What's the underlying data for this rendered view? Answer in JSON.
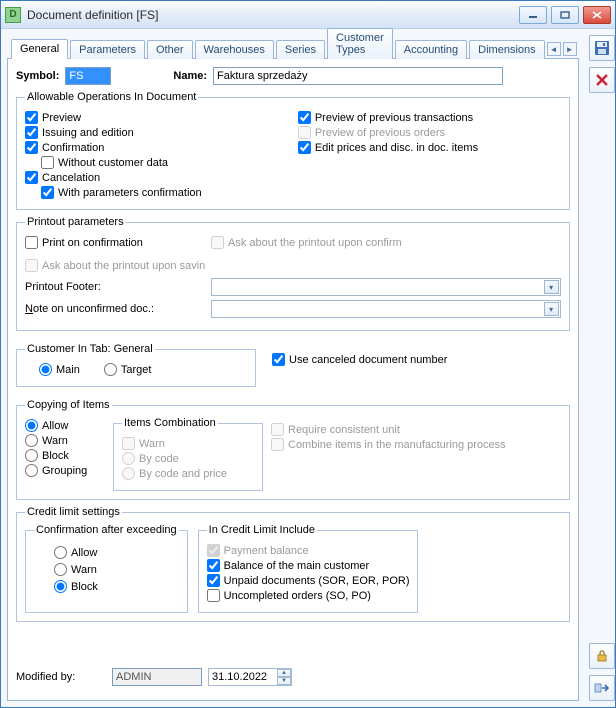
{
  "window": {
    "title": "Document definition [FS]"
  },
  "tabs": [
    "General",
    "Parameters",
    "Other",
    "Warehouses",
    "Series",
    "Customer Types",
    "Accounting",
    "Dimensions"
  ],
  "active_tab": 0,
  "header": {
    "symbol_label": "Symbol:",
    "symbol_value": "FS",
    "name_label": "Name:",
    "name_value": "Faktura sprzedaży"
  },
  "allowable": {
    "legend": "Allowable Operations In Document",
    "preview": "Preview",
    "issuing": "Issuing and edition",
    "confirmation": "Confirmation",
    "without_customer": "Without customer data",
    "cancelation": "Cancelation",
    "with_params": "With parameters confirmation",
    "prev_trans": "Preview of previous transactions",
    "prev_orders": "Preview of previous orders",
    "edit_prices": "Edit prices and disc. in doc. items"
  },
  "printout": {
    "legend": "Printout parameters",
    "print_on_conf": "Print on confirmation",
    "ask_confirm": "Ask about the printout upon confirm",
    "ask_save": "Ask about the printout upon savin",
    "footer_label": "Printout Footer:",
    "note_label": "Note on unconfirmed doc.:"
  },
  "customer_tab": {
    "legend": "Customer In Tab: General",
    "main": "Main",
    "target": "Target",
    "use_canceled": "Use canceled document number"
  },
  "copying": {
    "legend": "Copying of Items",
    "allow": "Allow",
    "warn": "Warn",
    "block": "Block",
    "grouping": "Grouping",
    "combo_legend": "Items Combination",
    "combo_warn": "Warn",
    "combo_bycode": "By code",
    "combo_bycodeprice": "By code and price",
    "req_unit": "Require consistent unit",
    "combine_mfg": "Combine items in the manufacturing process"
  },
  "credit": {
    "legend": "Credit limit settings",
    "conf_legend": "Confirmation after exceeding",
    "allow": "Allow",
    "warn": "Warn",
    "block": "Block",
    "include_legend": "In Credit Limit Include",
    "pay_balance": "Payment balance",
    "main_cust": "Balance of the main customer",
    "unpaid": "Unpaid documents (SOR, EOR, POR)",
    "uncompleted": "Uncompleted orders (SO, PO)"
  },
  "footer": {
    "modified_label": "Modified by:",
    "modified_user": "ADMIN",
    "modified_date": "31.10.2022"
  }
}
